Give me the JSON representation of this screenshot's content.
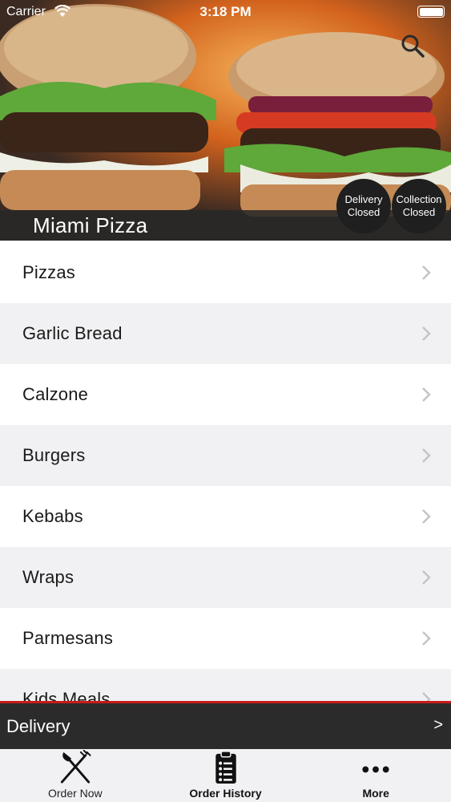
{
  "status_bar": {
    "carrier": "Carrier",
    "time": "3:18 PM"
  },
  "hero": {
    "store_name": "Miami Pizza",
    "delivery_status": {
      "line1": "Delivery",
      "line2": "Closed"
    },
    "collection_status": {
      "line1": "Collection",
      "line2": "Closed"
    }
  },
  "menu": {
    "items": [
      {
        "label": "Pizzas"
      },
      {
        "label": "Garlic Bread"
      },
      {
        "label": "Calzone"
      },
      {
        "label": "Burgers"
      },
      {
        "label": "Kebabs"
      },
      {
        "label": "Wraps"
      },
      {
        "label": "Parmesans"
      },
      {
        "label": "Kids Meals"
      }
    ]
  },
  "delivery_bar": {
    "label": "Delivery",
    "arrow": ">"
  },
  "tabs": [
    {
      "label": "Order Now",
      "icon": "fork-knife-icon"
    },
    {
      "label": "Order History",
      "icon": "clipboard-list-icon"
    },
    {
      "label": "More",
      "icon": "more-dots-icon"
    }
  ],
  "colors": {
    "accent_red": "#c61b1b",
    "bar_dark": "#2b2b2b",
    "row_alt": "#f1f1f3"
  }
}
